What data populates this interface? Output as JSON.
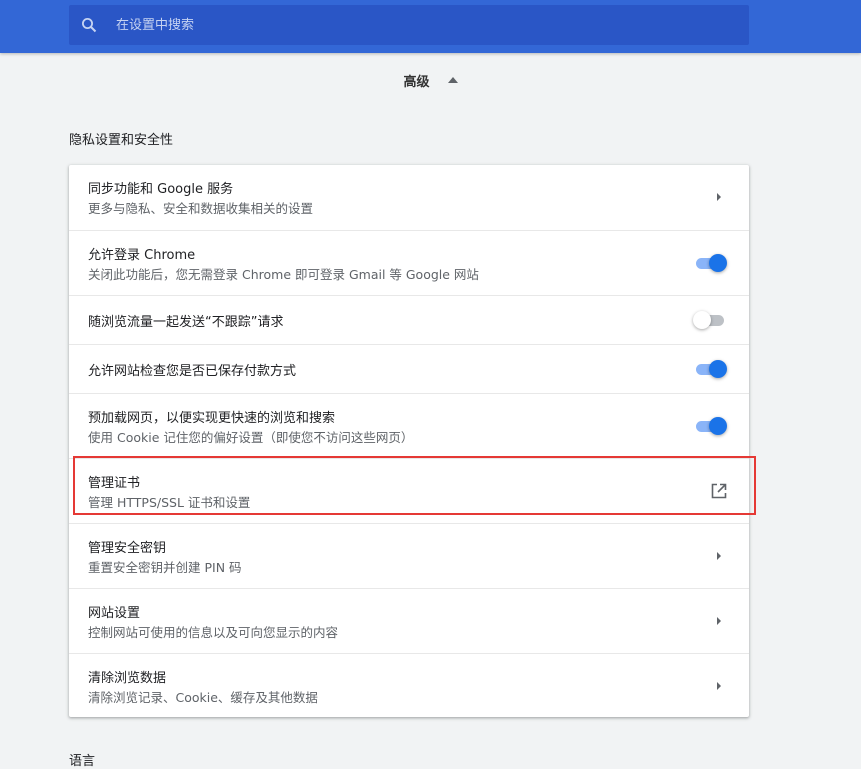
{
  "search": {
    "placeholder": "在设置中搜索",
    "icon": "search-icon"
  },
  "advanced": {
    "label": "高级",
    "icon": "arrow-up-icon"
  },
  "privacy_section": {
    "title": "隐私设置和安全性",
    "items": [
      {
        "title": "同步功能和 Google 服务",
        "subtitle": "更多与隐私、安全和数据收集相关的设置",
        "control": "chevron"
      },
      {
        "title": "允许登录 Chrome",
        "subtitle": "关闭此功能后，您无需登录 Chrome 即可登录 Gmail 等 Google 网站",
        "control": "toggle",
        "on": true
      },
      {
        "title": "随浏览流量一起发送“不跟踪”请求",
        "subtitle": "",
        "control": "toggle",
        "on": false
      },
      {
        "title": "允许网站检查您是否已保存付款方式",
        "subtitle": "",
        "control": "toggle",
        "on": true
      },
      {
        "title": "预加载网页，以便实现更快速的浏览和搜索",
        "subtitle": "使用 Cookie 记住您的偏好设置（即使您不访问这些网页）",
        "control": "toggle",
        "on": true
      },
      {
        "title": "管理证书",
        "subtitle": "管理 HTTPS/SSL 证书和设置",
        "control": "external-link"
      },
      {
        "title": "管理安全密钥",
        "subtitle": "重置安全密钥并创建 PIN 码",
        "control": "chevron"
      },
      {
        "title": "网站设置",
        "subtitle": "控制网站可使用的信息以及可向您显示的内容",
        "control": "chevron"
      },
      {
        "title": "清除浏览数据",
        "subtitle": "清除浏览记录、Cookie、缓存及其他数据",
        "control": "chevron"
      }
    ]
  },
  "language_section": {
    "title": "语言"
  },
  "colors": {
    "topbar": "#3367d6",
    "accent": "#1a73e8",
    "highlight": "#e53935"
  }
}
